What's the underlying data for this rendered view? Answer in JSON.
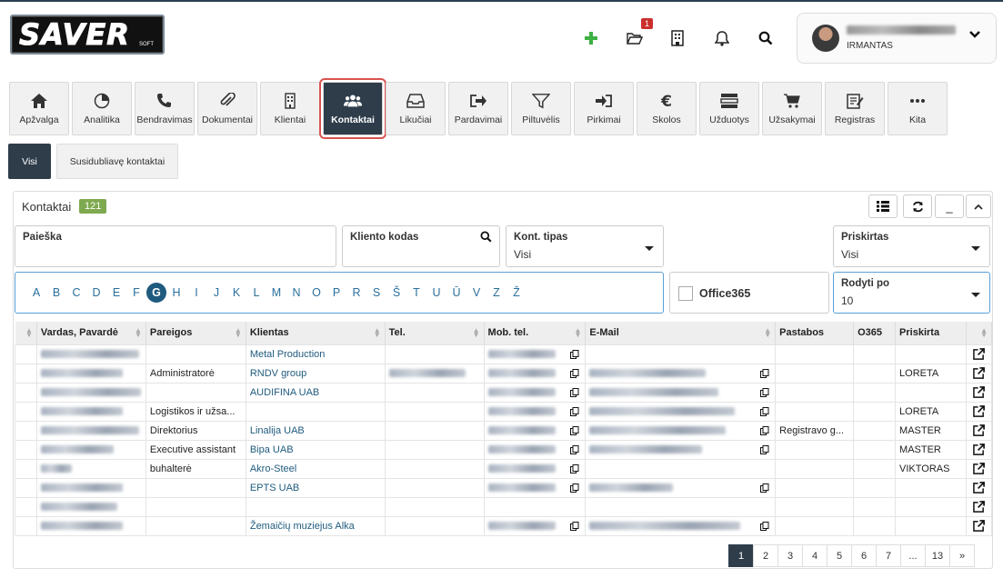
{
  "header": {
    "logo_text": "SAVER",
    "logo_sub": "SOFT",
    "icons": [
      "plus-icon",
      "folder-open-icon",
      "building-icon",
      "bell-icon",
      "search-icon"
    ],
    "folder_badge": "1",
    "user_role": "IRMANTAS",
    "accent_color": "#2f3d4b",
    "plus_color": "#3cb043"
  },
  "nav": {
    "items": [
      {
        "label": "Apžvalga",
        "icon": "home-icon"
      },
      {
        "label": "Analitika",
        "icon": "pie-chart-icon"
      },
      {
        "label": "Bendravimas",
        "icon": "phone-icon"
      },
      {
        "label": "Dokumentai",
        "icon": "paperclip-icon"
      },
      {
        "label": "Klientai",
        "icon": "building-icon"
      },
      {
        "label": "Kontaktai",
        "icon": "users-icon",
        "active": true
      },
      {
        "label": "Likučiai",
        "icon": "inbox-icon"
      },
      {
        "label": "Pardavimai",
        "icon": "sign-out-icon"
      },
      {
        "label": "Piltuvėlis",
        "icon": "funnel-icon"
      },
      {
        "label": "Pirkimai",
        "icon": "sign-in-icon"
      },
      {
        "label": "Skolos",
        "icon": "euro-icon"
      },
      {
        "label": "Užduotys",
        "icon": "tasks-icon"
      },
      {
        "label": "Užsakymai",
        "icon": "cart-icon"
      },
      {
        "label": "Registras",
        "icon": "register-icon"
      },
      {
        "label": "Kita",
        "icon": "ellipsis-icon"
      }
    ]
  },
  "subtabs": {
    "all": "Visi",
    "duplicates": "Susidubliavę kontaktai"
  },
  "panel": {
    "title": "Kontaktai",
    "count": "121",
    "buttons": {
      "min": "_"
    }
  },
  "filters": {
    "search": {
      "label": "Paieška",
      "value": ""
    },
    "client_code": {
      "label": "Kliento kodas",
      "value": ""
    },
    "contact_type": {
      "label": "Kont. tipas",
      "value": "Visi"
    },
    "assigned": {
      "label": "Priskirtas",
      "value": "Visi"
    },
    "office365": {
      "label": "Office365"
    },
    "page_size": {
      "label": "Rodyti po",
      "value": "10"
    }
  },
  "alphabet": [
    "A",
    "B",
    "C",
    "D",
    "E",
    "F",
    "G",
    "H",
    "I",
    "J",
    "K",
    "L",
    "M",
    "N",
    "O",
    "P",
    "R",
    "S",
    "Š",
    "T",
    "U",
    "Ū",
    "V",
    "Z",
    "Ž"
  ],
  "alphabet_selected": "G",
  "table": {
    "columns": [
      "Vardas, Pavardė",
      "Pareigos",
      "Klientas",
      "Tel.",
      "Mob. tel.",
      "E-Mail",
      "Pastabos",
      "O365",
      "Priskirta",
      ""
    ],
    "rows": [
      {
        "position": "",
        "client": "Metal Production",
        "note": "",
        "assigned": ""
      },
      {
        "position": "Administratorė",
        "client": "RNDV group",
        "note": "",
        "assigned": "LORETA"
      },
      {
        "position": "",
        "client": "AUDIFINA UAB",
        "note": "",
        "assigned": ""
      },
      {
        "position": "Logistikos ir užsa...",
        "client": "",
        "note": "",
        "assigned": "LORETA"
      },
      {
        "position": "Direktorius",
        "client": "Linalija UAB",
        "note": "Registravo g...",
        "assigned": "MASTER"
      },
      {
        "position": "Executive assistant",
        "client": "Bipa UAB",
        "note": "",
        "assigned": "MASTER"
      },
      {
        "position": "buhalterė",
        "client": "Akro-Steel",
        "note": "",
        "assigned": "VIKTORAS"
      },
      {
        "position": "",
        "client": "EPTS UAB",
        "note": "",
        "assigned": ""
      },
      {
        "position": "",
        "client": "",
        "note": "",
        "assigned": ""
      },
      {
        "position": "",
        "client": "Žemaičių muziejus Alka",
        "note": "",
        "assigned": ""
      }
    ]
  },
  "pagination": [
    "1",
    "2",
    "3",
    "4",
    "5",
    "6",
    "7",
    "...",
    "13",
    "»"
  ],
  "pagination_current": "1"
}
